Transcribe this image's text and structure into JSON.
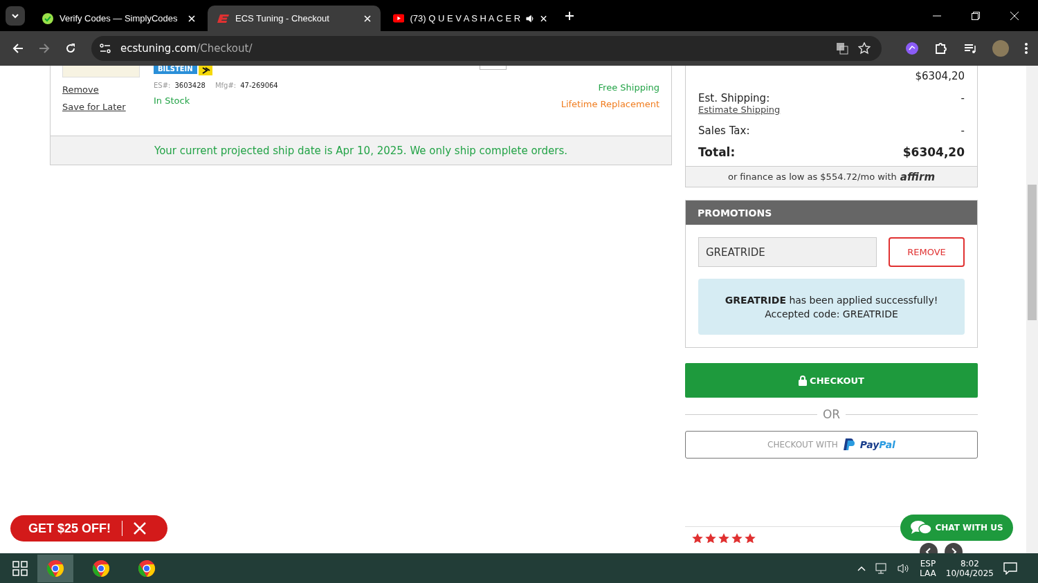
{
  "tabs": [
    {
      "title": "Verify Codes — SimplyCodes",
      "selected": false,
      "kind": "simplycodes",
      "audio": false
    },
    {
      "title": "ECS Tuning - Checkout",
      "selected": true,
      "kind": "ecs",
      "audio": false
    },
    {
      "title": "(73) Q U E V A S H A C E R",
      "selected": false,
      "kind": "youtube",
      "audio": true
    }
  ],
  "address": {
    "domain": "ecstuning.com",
    "path": "/Checkout/"
  },
  "cart_item": {
    "brand_badge": "BILSTEIN",
    "links": [
      "Remove",
      "Save for Later"
    ],
    "es_label": "ES#:",
    "es_number": "3603428",
    "mfg_label": "Mfg#:",
    "mfg_number": "47-269064",
    "stock": "In Stock",
    "shipping": "Free Shipping",
    "warranty": "Lifetime Replacement"
  },
  "ship_notice": "Your current projected ship date is Apr 10, 2025. We only ship complete orders.",
  "summary": {
    "subtotal": "$6304,20",
    "shipping_label": "Est. Shipping:",
    "shipping_link": "Estimate Shipping",
    "shipping_value": "-",
    "tax_label": "Sales Tax:",
    "tax_value": "-",
    "total_label": "Total:",
    "total_value": "$6304,20",
    "finance": "or finance as low as $554.72/mo with",
    "finance_brand": "affirm"
  },
  "promotions": {
    "title": "PROMOTIONS",
    "code": "GREATRIDE",
    "remove_button": "REMOVE",
    "message": "**GREATRIDE** has been applied successfully!",
    "accepted": "Accepted code: GREATRIDE"
  },
  "checkout_button": "CHECKOUT",
  "or_label": "OR",
  "paypal_button": {
    "label": "CHECKOUT WITH",
    "brand_1": "Pay",
    "brand_2": "Pal"
  },
  "discount_pill": "GET $25 OFF!",
  "chat_button": "CHAT WITH US",
  "taskbar": {
    "language": "ESP",
    "layout": "LAA",
    "time": "8:02",
    "date": "10/04/2025"
  }
}
